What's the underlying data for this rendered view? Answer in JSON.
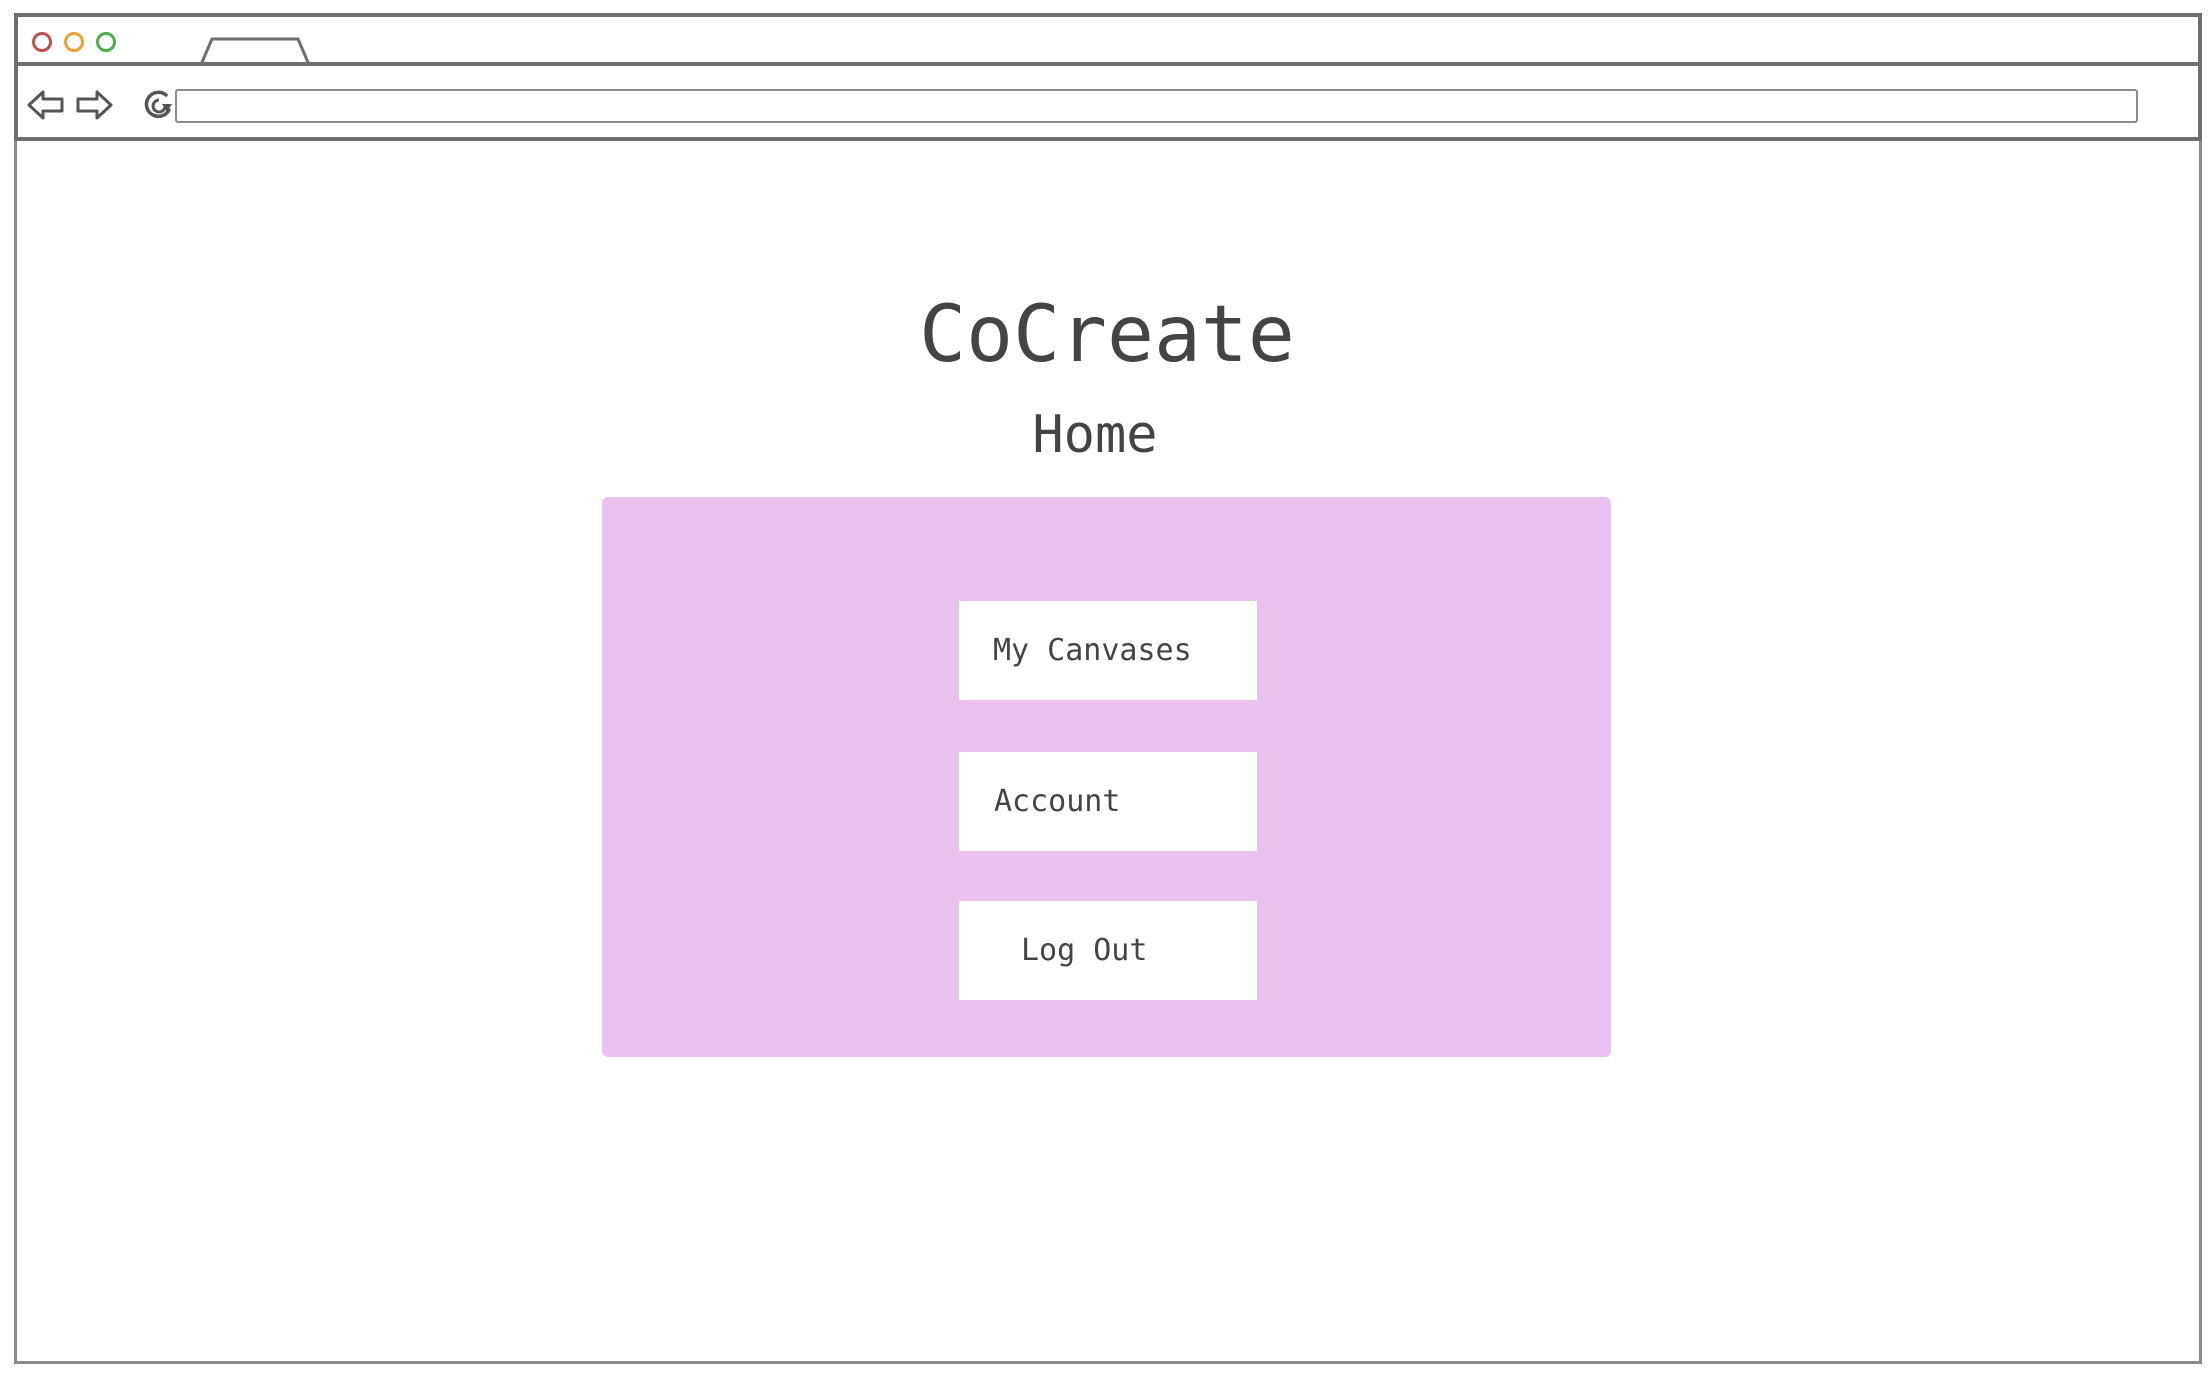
{
  "browser": {
    "tab_title": "",
    "url": ""
  },
  "page": {
    "title": "CoCreate",
    "subtitle": "Home"
  },
  "menu": {
    "buttons": [
      {
        "label": "My Canvases"
      },
      {
        "label": "Account"
      },
      {
        "label": "Log Out"
      }
    ]
  },
  "colors": {
    "panel_background": "#ebc1ef",
    "text": "#444444",
    "window_close": "#c0504d",
    "window_minimize": "#f0a030",
    "window_maximize": "#4cae4c"
  },
  "icons": {
    "back": "back-arrow-icon",
    "forward": "forward-arrow-icon",
    "reload": "reload-icon"
  }
}
